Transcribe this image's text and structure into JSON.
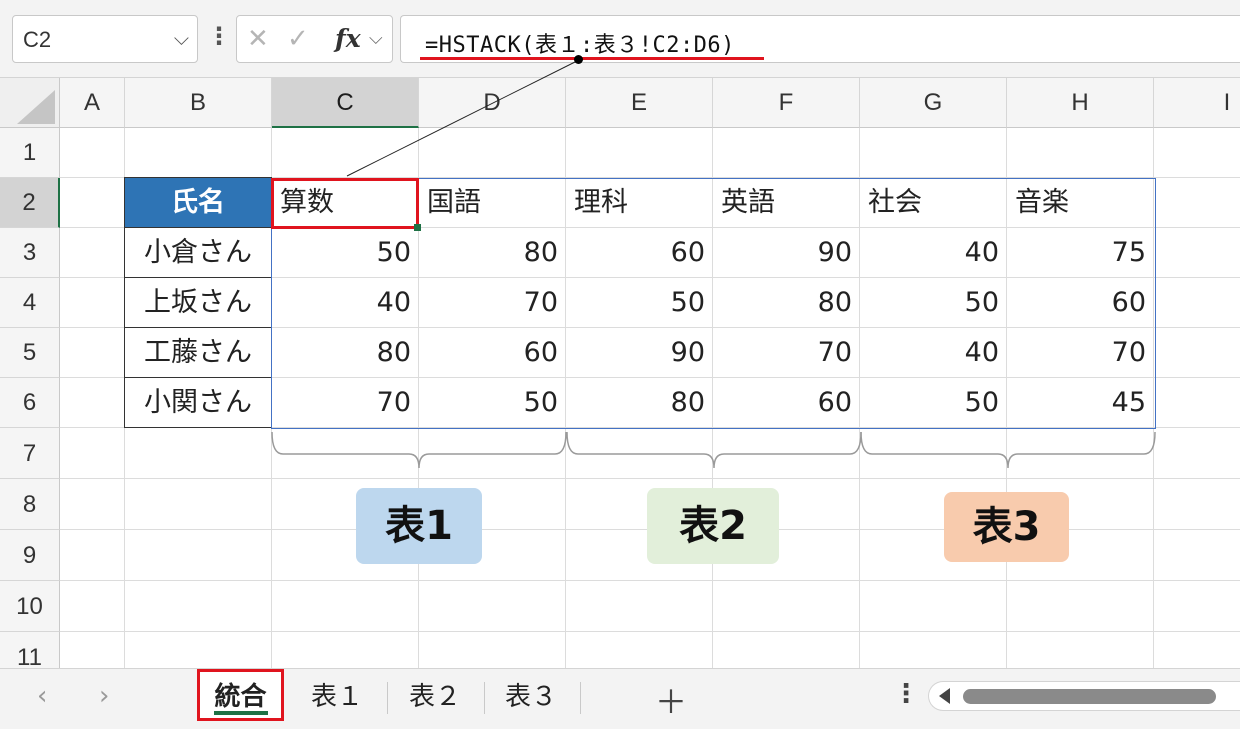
{
  "formula_bar": {
    "name_box": "C2",
    "formula": "=HSTACK(表１:表３!C2:D6)",
    "icons": [
      "cancel-icon",
      "enter-icon",
      "fx-icon"
    ]
  },
  "columns": [
    "A",
    "B",
    "C",
    "D",
    "E",
    "F",
    "G",
    "H",
    "I"
  ],
  "rows": [
    "1",
    "2",
    "3",
    "4",
    "5",
    "6",
    "7",
    "8",
    "9",
    "10",
    "11"
  ],
  "active_cell": "C2",
  "table": {
    "name_header": "氏名",
    "names": [
      "小倉さん",
      "上坂さん",
      "工藤さん",
      "小関さん"
    ],
    "subjects": [
      "算数",
      "国語",
      "理科",
      "英語",
      "社会",
      "音楽"
    ],
    "values": [
      [
        50,
        80,
        60,
        90,
        40,
        75
      ],
      [
        40,
        70,
        50,
        80,
        50,
        60
      ],
      [
        80,
        60,
        90,
        70,
        40,
        70
      ],
      [
        70,
        50,
        80,
        60,
        50,
        45
      ]
    ]
  },
  "badges": [
    {
      "label": "表1",
      "color": "#bdd7ee"
    },
    {
      "label": "表2",
      "color": "#e2efda"
    },
    {
      "label": "表3",
      "color": "#f8cbad"
    }
  ],
  "sheet_tabs": [
    {
      "label": "統合",
      "active": true
    },
    {
      "label": "表１",
      "active": false
    },
    {
      "label": "表２",
      "active": false
    },
    {
      "label": "表３",
      "active": false
    }
  ],
  "accent_colors": {
    "highlight_red": "#e0141e",
    "excel_green": "#1e7145",
    "header_blue": "#2e74b5",
    "table_outline": "#4472c4"
  }
}
